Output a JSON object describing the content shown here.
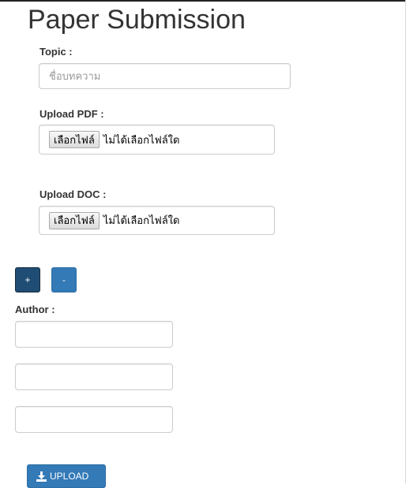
{
  "page": {
    "title": "Paper Submission"
  },
  "topic": {
    "label": "Topic :",
    "placeholder": "ชื่อบทความ",
    "value": ""
  },
  "upload_pdf": {
    "label": "Upload PDF :",
    "choose_label": "เลือกไฟล์",
    "status": "ไม่ได้เลือกไฟล์ใด"
  },
  "upload_doc": {
    "label": "Upload DOC :",
    "choose_label": "เลือกไฟล์",
    "status": "ไม่ได้เลือกไฟล์ใด"
  },
  "author_controls": {
    "add_label": "+",
    "remove_label": "-"
  },
  "author": {
    "label": "Author :",
    "fields": [
      {
        "value": ""
      },
      {
        "value": ""
      },
      {
        "value": ""
      }
    ]
  },
  "upload_button": {
    "label": "UPLOAD",
    "icon": "download-icon"
  },
  "colors": {
    "primary": "#337ab7",
    "primary_dark": "#204d74"
  }
}
